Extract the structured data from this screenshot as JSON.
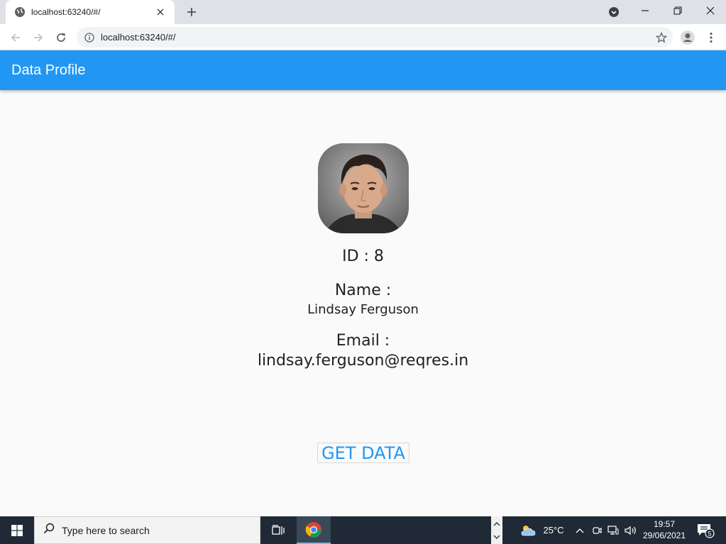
{
  "browser": {
    "tab_title": "localhost:63240/#/",
    "url": "localhost:63240/#/"
  },
  "app": {
    "title": "Data Profile",
    "accent_color": "#2196f3"
  },
  "profile": {
    "id_line": "ID : 8",
    "name_label": "Name :",
    "name_value": "Lindsay Ferguson",
    "email_label": "Email :",
    "email_value": "lindsay.ferguson@reqres.in",
    "button_label": "GET DATA"
  },
  "taskbar": {
    "search_placeholder": "Type here to search",
    "temperature": "25°C",
    "time": "19:57",
    "date": "29/06/2021",
    "notification_count": "5"
  }
}
